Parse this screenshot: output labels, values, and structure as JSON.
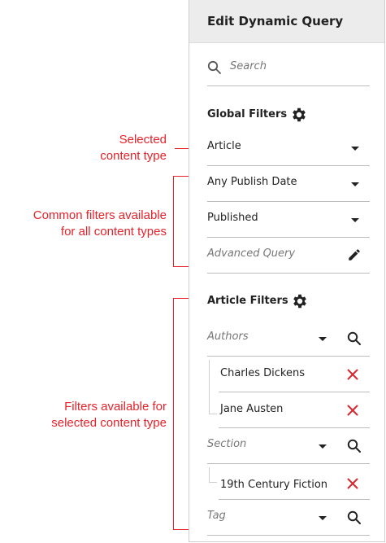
{
  "annotations": {
    "selected_type": [
      "Selected",
      "content type"
    ],
    "common_filters": [
      "Common filters available",
      "for all content types"
    ],
    "type_filters": [
      "Filters available for",
      "selected content type"
    ]
  },
  "panel": {
    "title": "Edit Dynamic Query",
    "search_placeholder": "Search",
    "global_filters_title": "Global Filters",
    "content_type": "Article",
    "publish_date": "Any Publish Date",
    "status": "Published",
    "advanced_query": "Advanced Query",
    "article_filters_title": "Article Filters",
    "authors_label": "Authors",
    "authors": [
      "Charles Dickens",
      "Jane Austen"
    ],
    "section_label": "Section",
    "sections": [
      "19th Century Fiction"
    ],
    "tag_label": "Tag"
  },
  "colors": {
    "annotation": "#e8222a",
    "remove": "#d9272e"
  },
  "icons": {
    "search": "search-icon",
    "gear": "gear-icon",
    "pencil": "pencil-icon",
    "remove": "close-icon",
    "dropdown": "chevron-down-icon"
  }
}
